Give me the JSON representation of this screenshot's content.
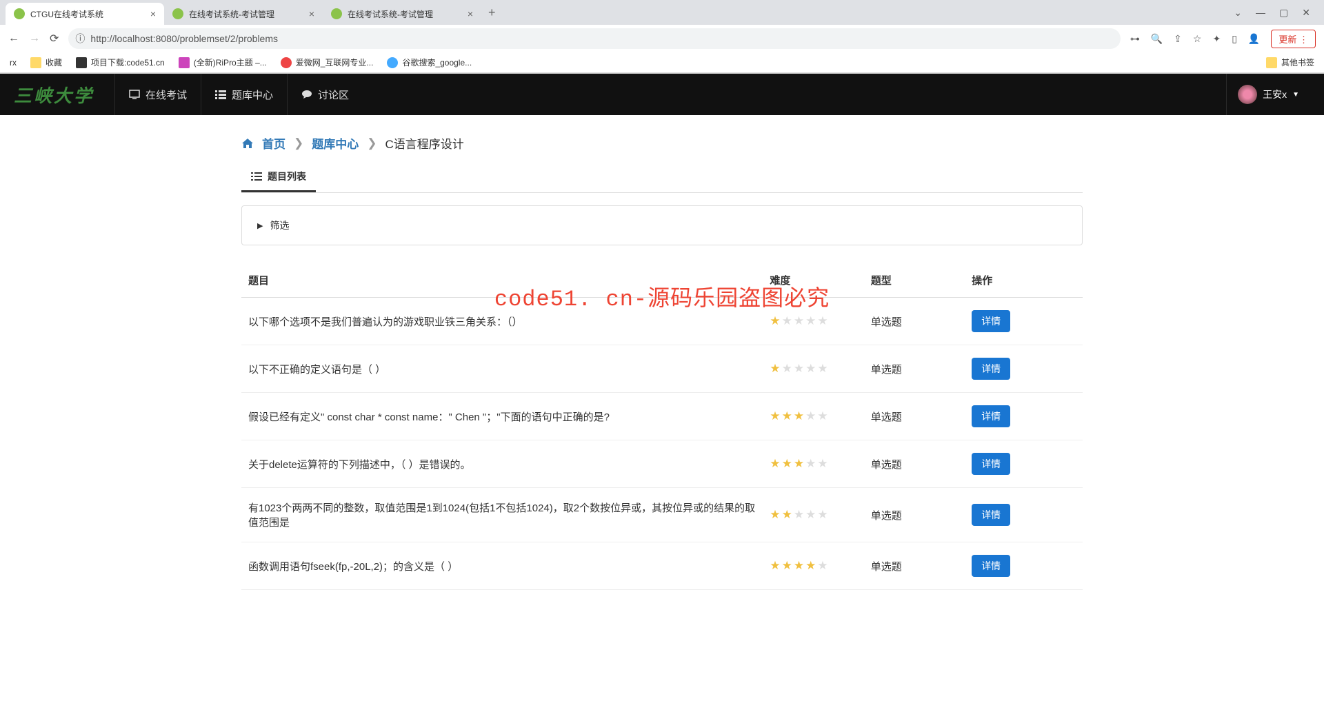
{
  "browser": {
    "tabs": [
      {
        "title": "CTGU在线考试系统"
      },
      {
        "title": "在线考试系统-考试管理"
      },
      {
        "title": "在线考试系统-考试管理"
      }
    ],
    "url": "http://localhost:8080/problemset/2/problems",
    "update_label": "更新",
    "bookmarks": [
      {
        "label": "rx"
      },
      {
        "label": "收藏"
      },
      {
        "label": "项目下载:code51.cn"
      },
      {
        "label": "(全新)RiPro主题 –..."
      },
      {
        "label": "爱微网_互联网专业..."
      },
      {
        "label": "谷歌搜索_google..."
      }
    ],
    "other_bookmarks": "其他书签"
  },
  "navbar": {
    "logo": "三峡大学",
    "items": [
      {
        "label": "在线考试"
      },
      {
        "label": "题库中心"
      },
      {
        "label": "讨论区"
      }
    ],
    "user": "王安x"
  },
  "breadcrumb": {
    "home": "首页",
    "center": "题库中心",
    "current": "C语言程序设计"
  },
  "tab_title": "题目列表",
  "filter_label": "筛选",
  "headers": {
    "title": "题目",
    "difficulty": "难度",
    "type": "题型",
    "action": "操作"
  },
  "detail_btn": "详情",
  "rows": [
    {
      "title": "以下哪个选项不是我们普遍认为的游戏职业铁三角关系：（）",
      "stars": 1,
      "type": "单选题"
    },
    {
      "title": "以下不正确的定义语句是（ ）",
      "stars": 1,
      "type": "单选题"
    },
    {
      "title": "假设已经有定义\" const char * const name：\" Chen \"；\"下面的语句中正确的是?",
      "stars": 3,
      "type": "单选题"
    },
    {
      "title": "关于delete运算符的下列描述中，（ ）是错误的。",
      "stars": 3,
      "type": "单选题"
    },
    {
      "title": "有1023个两两不同的整数，取值范围是1到1024(包括1不包括1024)，取2个数按位异或，其按位异或的结果的取值范围是",
      "stars": 2,
      "type": "单选题"
    },
    {
      "title": "函数调用语句fseek(fp,-20L,2)；的含义是（ ）",
      "stars": 4,
      "type": "单选题"
    }
  ],
  "watermark": "code51. cn-源码乐园盗图必究"
}
